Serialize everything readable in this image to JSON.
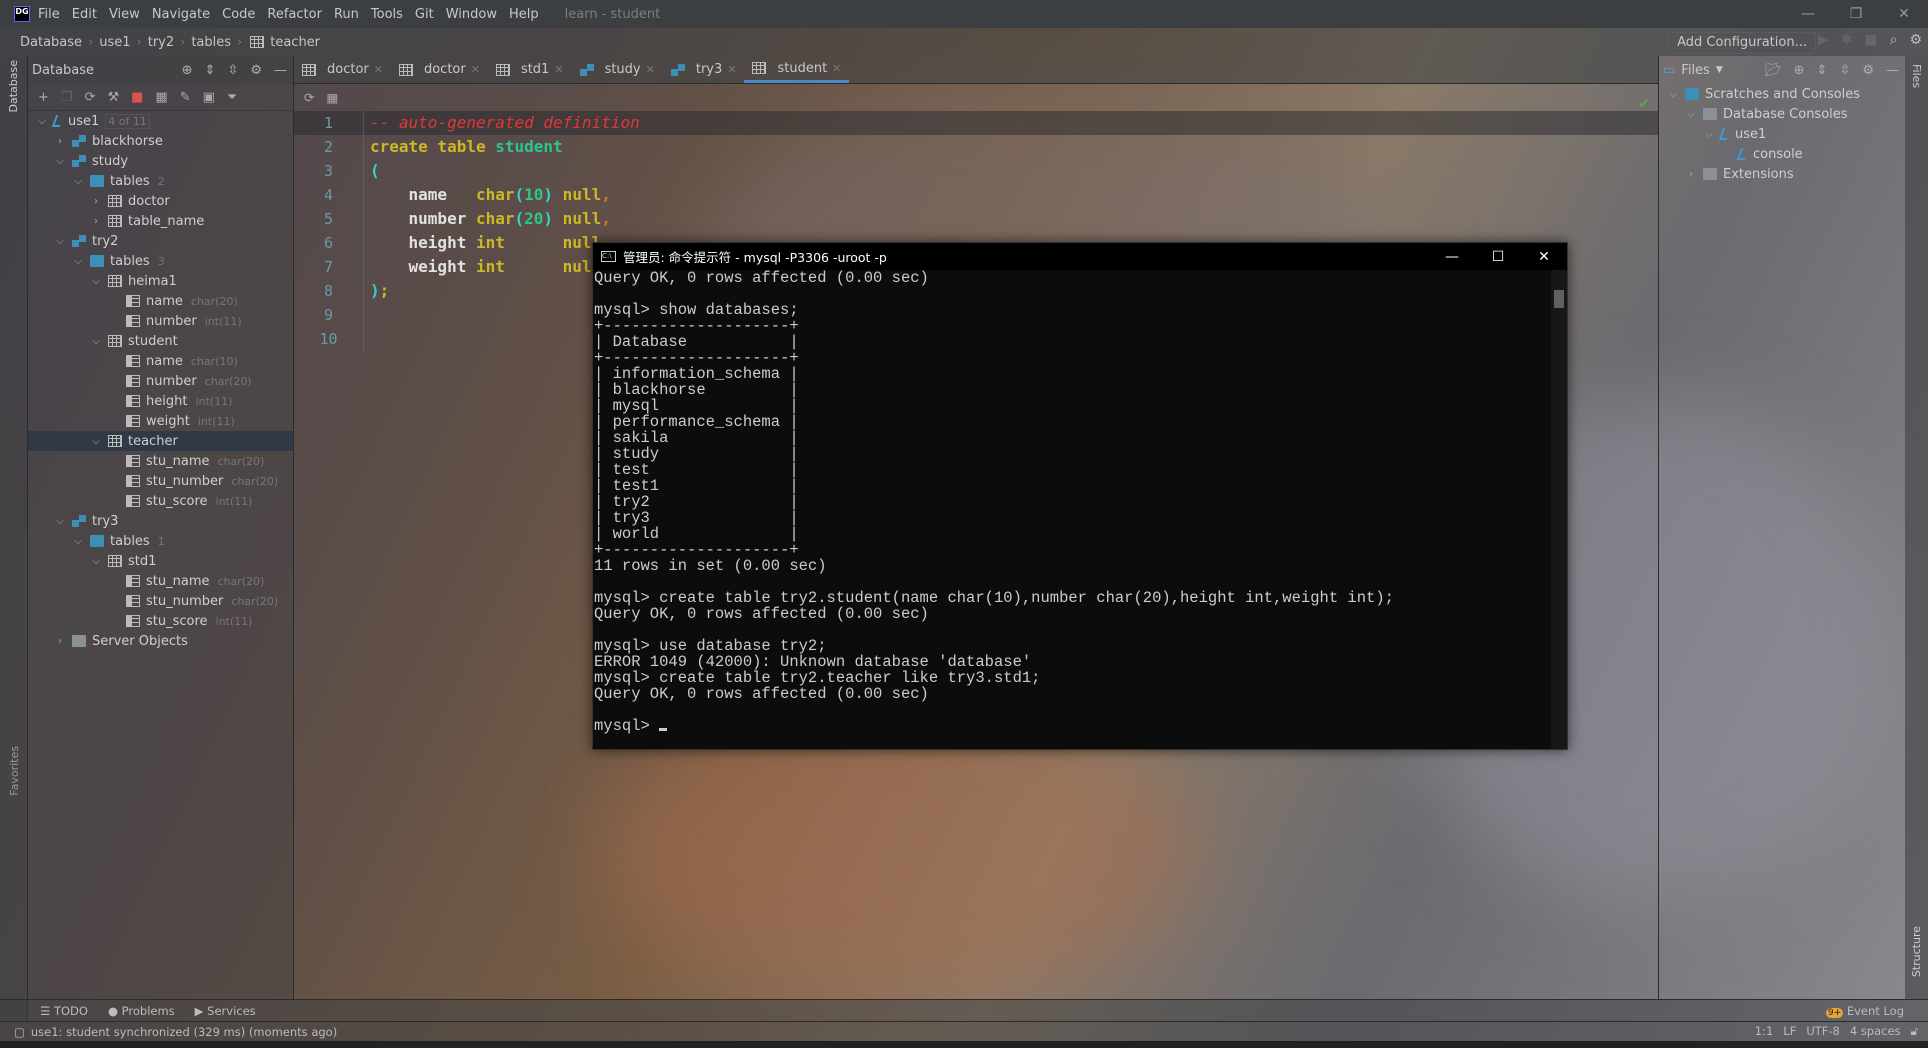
{
  "app": {
    "logo": "DG",
    "project_title": "learn - student"
  },
  "menu": [
    "File",
    "Edit",
    "View",
    "Navigate",
    "Code",
    "Refactor",
    "Run",
    "Tools",
    "Git",
    "Window",
    "Help"
  ],
  "breadcrumb": [
    "Database",
    "use1",
    "try2",
    "tables",
    "teacher"
  ],
  "toolbar_right": {
    "add_configuration": "Add Configuration..."
  },
  "left_stripe": {
    "database_tab": "Database",
    "favorites_tab": "Favorites"
  },
  "db_panel": {
    "title": "Database",
    "tree": [
      {
        "depth": 0,
        "icon": "conn",
        "label": "use1",
        "badge": "4 of 11",
        "open": true
      },
      {
        "depth": 1,
        "icon": "schema",
        "label": "blackhorse",
        "open": false
      },
      {
        "depth": 1,
        "icon": "schema",
        "label": "study",
        "open": true
      },
      {
        "depth": 2,
        "icon": "folder",
        "label": "tables",
        "count": "2",
        "open": true
      },
      {
        "depth": 3,
        "icon": "table",
        "label": "doctor",
        "open": false
      },
      {
        "depth": 3,
        "icon": "table",
        "label": "table_name",
        "open": false
      },
      {
        "depth": 1,
        "icon": "schema",
        "label": "try2",
        "open": true
      },
      {
        "depth": 2,
        "icon": "folder",
        "label": "tables",
        "count": "3",
        "open": true
      },
      {
        "depth": 3,
        "icon": "table",
        "label": "heima1",
        "open": true
      },
      {
        "depth": 4,
        "icon": "column",
        "label": "name",
        "hint": "char(20)"
      },
      {
        "depth": 4,
        "icon": "column",
        "label": "number",
        "hint": "int(11)"
      },
      {
        "depth": 3,
        "icon": "table",
        "label": "student",
        "open": true
      },
      {
        "depth": 4,
        "icon": "column",
        "label": "name",
        "hint": "char(10)"
      },
      {
        "depth": 4,
        "icon": "column",
        "label": "number",
        "hint": "char(20)"
      },
      {
        "depth": 4,
        "icon": "column",
        "label": "height",
        "hint": "int(11)"
      },
      {
        "depth": 4,
        "icon": "column",
        "label": "weight",
        "hint": "int(11)"
      },
      {
        "depth": 3,
        "icon": "table",
        "label": "teacher",
        "open": true,
        "selected": true
      },
      {
        "depth": 4,
        "icon": "column",
        "label": "stu_name",
        "hint": "char(20)"
      },
      {
        "depth": 4,
        "icon": "column",
        "label": "stu_number",
        "hint": "char(20)"
      },
      {
        "depth": 4,
        "icon": "column",
        "label": "stu_score",
        "hint": "int(11)"
      },
      {
        "depth": 1,
        "icon": "schema",
        "label": "try3",
        "open": true
      },
      {
        "depth": 2,
        "icon": "folder",
        "label": "tables",
        "count": "1",
        "open": true
      },
      {
        "depth": 3,
        "icon": "table",
        "label": "std1",
        "open": true
      },
      {
        "depth": 4,
        "icon": "column",
        "label": "stu_name",
        "hint": "char(20)"
      },
      {
        "depth": 4,
        "icon": "column",
        "label": "stu_number",
        "hint": "char(20)"
      },
      {
        "depth": 4,
        "icon": "column",
        "label": "stu_score",
        "hint": "int(11)"
      },
      {
        "depth": 1,
        "icon": "folder-gray",
        "label": "Server Objects",
        "open": false
      }
    ]
  },
  "editor": {
    "tabs": [
      {
        "label": "doctor",
        "icon": "table"
      },
      {
        "label": "doctor",
        "icon": "table"
      },
      {
        "label": "std1",
        "icon": "table"
      },
      {
        "label": "study",
        "icon": "schema"
      },
      {
        "label": "try3",
        "icon": "schema"
      },
      {
        "label": "student",
        "icon": "table",
        "active": true
      }
    ],
    "lines": [
      [
        [
          "cm",
          "-- auto-generated definition"
        ]
      ],
      [
        [
          "kw",
          "create table "
        ],
        [
          "id",
          "student"
        ]
      ],
      [
        [
          "pn",
          "("
        ]
      ],
      [
        [
          "col",
          "    name   "
        ],
        [
          "kw",
          "char"
        ],
        [
          "pn",
          "("
        ],
        [
          "nm",
          "10"
        ],
        [
          "pn",
          ")"
        ],
        [
          "kw",
          " null"
        ],
        [
          "cma",
          ","
        ]
      ],
      [
        [
          "col",
          "    number "
        ],
        [
          "kw",
          "char"
        ],
        [
          "pn",
          "("
        ],
        [
          "nm",
          "20"
        ],
        [
          "pn",
          ")"
        ],
        [
          "kw",
          " null"
        ],
        [
          "cma",
          ","
        ]
      ],
      [
        [
          "col",
          "    height "
        ],
        [
          "kw",
          "int      null"
        ],
        [
          "cma",
          ","
        ]
      ],
      [
        [
          "col",
          "    weight "
        ],
        [
          "kw",
          "int      null"
        ]
      ],
      [
        [
          "pn",
          ")"
        ],
        [
          "kw",
          ";"
        ]
      ],
      [],
      []
    ]
  },
  "right_panel": {
    "dropdown": "Files",
    "tree": [
      {
        "depth": 0,
        "label": "Scratches and Consoles",
        "open": true,
        "icon": "scratch"
      },
      {
        "depth": 1,
        "label": "Database Consoles",
        "open": true,
        "icon": "folder"
      },
      {
        "depth": 2,
        "label": "use1",
        "open": true,
        "icon": "conn"
      },
      {
        "depth": 3,
        "label": "console",
        "icon": "conn"
      },
      {
        "depth": 1,
        "label": "Extensions",
        "open": false,
        "icon": "folder"
      }
    ],
    "stripe_tab": "Files",
    "structure_tab": "Structure"
  },
  "terminal": {
    "title": "管理员: 命令提示符 - mysql   -P3306   -uroot   -p",
    "lines": [
      "Query OK, 0 rows affected (0.00 sec)",
      "",
      "mysql> show databases;",
      "+--------------------+",
      "| Database           |",
      "+--------------------+",
      "| information_schema |",
      "| blackhorse         |",
      "| mysql              |",
      "| performance_schema |",
      "| sakila             |",
      "| study              |",
      "| test               |",
      "| test1              |",
      "| try2               |",
      "| try3               |",
      "| world              |",
      "+--------------------+",
      "11 rows in set (0.00 sec)",
      "",
      "mysql> create table try2.student(name char(10),number char(20),height int,weight int);",
      "Query OK, 0 rows affected (0.00 sec)",
      "",
      "mysql> use database try2;",
      "ERROR 1049 (42000): Unknown database 'database'",
      "mysql> create table try2.teacher like try3.std1;",
      "Query OK, 0 rows affected (0.00 sec)",
      "",
      "mysql> "
    ]
  },
  "bottom_tools": {
    "todo": "TODO",
    "problems": "Problems",
    "services": "Services",
    "event_log": "Event Log",
    "event_badge": "9+"
  },
  "status": {
    "message": "use1: student synchronized (329 ms) (moments ago)",
    "position": "1:1",
    "line_sep": "LF",
    "encoding": "UTF-8",
    "indent": "4 spaces"
  }
}
